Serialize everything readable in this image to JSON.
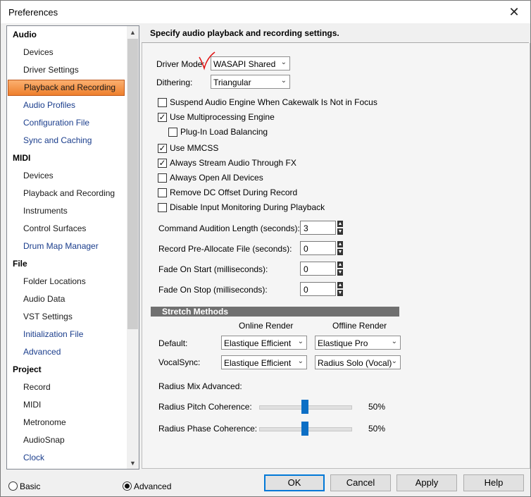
{
  "window": {
    "title": "Preferences"
  },
  "nav": {
    "items": [
      {
        "label": "Audio",
        "kind": "category"
      },
      {
        "label": "Devices",
        "kind": "plain"
      },
      {
        "label": "Driver Settings",
        "kind": "plain"
      },
      {
        "label": "Playback and Recording",
        "kind": "selected"
      },
      {
        "label": "Audio Profiles",
        "kind": "link"
      },
      {
        "label": "Configuration File",
        "kind": "link"
      },
      {
        "label": "Sync and Caching",
        "kind": "link"
      },
      {
        "label": "MIDI",
        "kind": "category"
      },
      {
        "label": "Devices",
        "kind": "plain"
      },
      {
        "label": "Playback and Recording",
        "kind": "plain"
      },
      {
        "label": "Instruments",
        "kind": "plain"
      },
      {
        "label": "Control Surfaces",
        "kind": "plain"
      },
      {
        "label": "Drum Map Manager",
        "kind": "link"
      },
      {
        "label": "File",
        "kind": "category"
      },
      {
        "label": "Folder Locations",
        "kind": "plain"
      },
      {
        "label": "Audio Data",
        "kind": "plain"
      },
      {
        "label": "VST Settings",
        "kind": "plain"
      },
      {
        "label": "Initialization File",
        "kind": "link"
      },
      {
        "label": "Advanced",
        "kind": "link"
      },
      {
        "label": "Project",
        "kind": "category"
      },
      {
        "label": "Record",
        "kind": "plain"
      },
      {
        "label": "MIDI",
        "kind": "plain"
      },
      {
        "label": "Metronome",
        "kind": "plain"
      },
      {
        "label": "AudioSnap",
        "kind": "plain"
      },
      {
        "label": "Clock",
        "kind": "link"
      }
    ]
  },
  "panel": {
    "header": "Specify audio playback and recording settings.",
    "driver_mode": {
      "label": "Driver Mode:",
      "value": "WASAPI Shared"
    },
    "dithering": {
      "label": "Dithering:",
      "value": "Triangular"
    },
    "checkboxes": [
      {
        "label": "Suspend Audio Engine When Cakewalk Is Not in Focus",
        "checked": false
      },
      {
        "label": "Use Multiprocessing Engine",
        "checked": true
      },
      {
        "label": "Plug-In Load Balancing",
        "checked": false
      },
      {
        "label": "Use MMCSS",
        "checked": true
      },
      {
        "label": "Always Stream Audio Through FX",
        "checked": true
      },
      {
        "label": "Always Open All Devices",
        "checked": false
      },
      {
        "label": "Remove DC Offset During Record",
        "checked": false
      },
      {
        "label": "Disable Input Monitoring During Playback",
        "checked": false
      }
    ],
    "numeric_fields": [
      {
        "label": "Command Audition Length (seconds):",
        "value": "3"
      },
      {
        "label": "Record Pre-Allocate File (seconds):",
        "value": "0"
      },
      {
        "label": "Fade On Start  (milliseconds):",
        "value": "0"
      },
      {
        "label": "Fade On Stop  (milliseconds):",
        "value": "0"
      }
    ],
    "stretch": {
      "title": "Stretch Methods",
      "col_online": "Online Render",
      "col_offline": "Offline Render",
      "default_label": "Default:",
      "default_online": "Elastique Efficient",
      "default_offline": "Elastique Pro",
      "vocal_label": "VocalSync:",
      "vocal_online": "Elastique Efficient",
      "vocal_offline": "Radius Solo (Vocal)"
    },
    "radius": {
      "heading": "Radius Mix Advanced:",
      "pitch_label": "Radius Pitch Coherence:",
      "pitch_value": "50%",
      "pitch_level": 0.5,
      "phase_label": "Radius Phase Coherence:",
      "phase_value": "50%",
      "phase_level": 0.5
    }
  },
  "footer": {
    "basic_label": "Basic",
    "advanced_label": "Advanced",
    "selected_mode": "Advanced",
    "ok": "OK",
    "cancel": "Cancel",
    "apply": "Apply",
    "help": "Help"
  },
  "colors": {
    "selection_top": "#fbb070",
    "selection_bottom": "#ee7f2c",
    "slider_thumb": "#0c6fc5",
    "link_text": "#1a3d8c",
    "annotation_mark": "#e01010"
  }
}
